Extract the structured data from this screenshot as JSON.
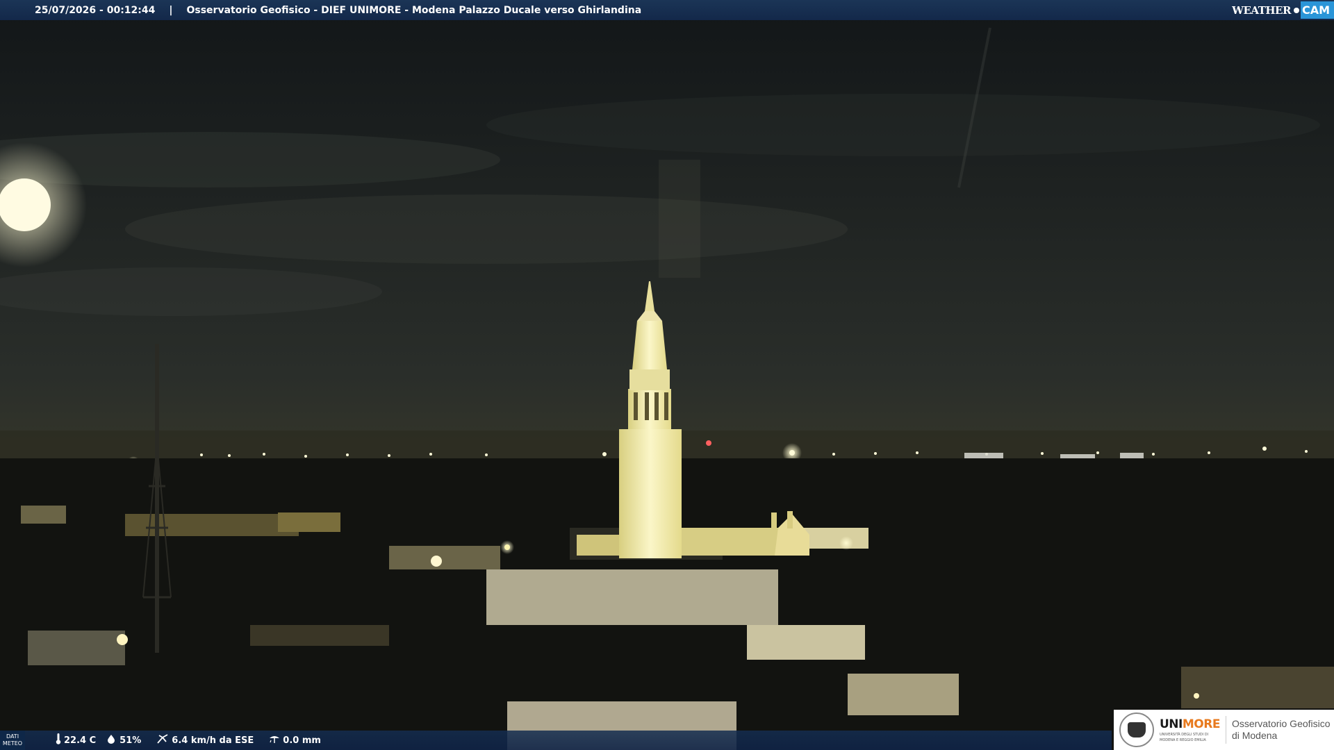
{
  "overlay": {
    "timestamp": "25/07/2026 - 00:12:44",
    "separator": "|",
    "title": "Osservatorio Geofisico - DIEF UNIMORE - Modena Palazzo Ducale verso Ghirlandina",
    "brand_weather": "WEATHER",
    "brand_cam": "CAM"
  },
  "meteo": {
    "label_line1": "DATI",
    "label_line2": "METEO",
    "temperature": "22.4 C",
    "humidity": "51%",
    "wind": "6.4 km/h da ESE",
    "rain": "0.0 mm",
    "icons": [
      "thermometer-icon",
      "humidity-drop-icon",
      "wind-icon",
      "rain-gauge-icon"
    ]
  },
  "logo": {
    "uni_a": "UNI",
    "uni_b": "MORE",
    "uni_sub1": "UNIVERSITÀ DEGLI STUDI DI",
    "uni_sub2": "MODENA E REGGIO EMILIA",
    "obs_line1": "Osservatorio Geofisico",
    "obs_line2": "di Modena"
  },
  "colors": {
    "bar": "#13284a",
    "cam_accent": "#2a95d8",
    "unimore_orange": "#e87a1e",
    "tower_light": "#f4eba8"
  }
}
